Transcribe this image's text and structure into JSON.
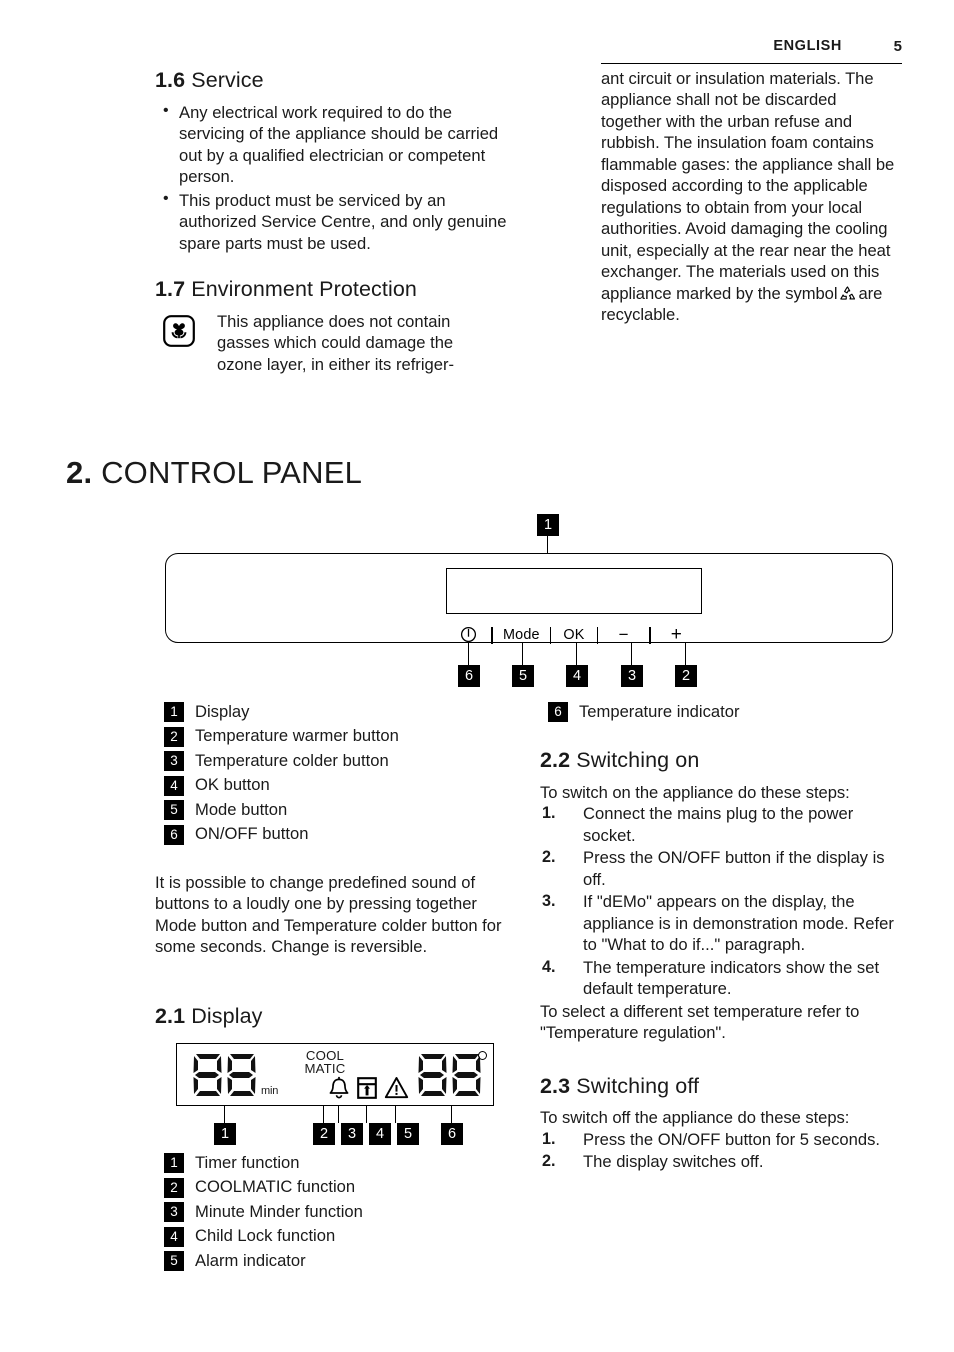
{
  "header": {
    "language": "ENGLISH",
    "page_number": "5"
  },
  "left_column": {
    "service": {
      "number": "1.6",
      "title": "Service",
      "bullets": [
        "Any electrical work required to do the servicing of the appliance should be carried out by a qualified electrician or competent person.",
        "This product must be serviced by an authorized Service Centre, and only genuine spare parts must be used."
      ]
    },
    "environment": {
      "number": "1.7",
      "title": "Environment Protection",
      "icon": "flower-icon",
      "text": "This appliance does not contain gasses which could damage the ozone layer, in either its refriger-"
    }
  },
  "right_column_top": {
    "continuation_part1": "ant circuit or insulation materials. The appliance shall not be discarded together with the urban refuse and rubbish. The insulation foam contains flammable gases: the appliance shall be disposed according to the applicable regulations to obtain from your local authorities. Avoid damaging the cooling unit, especially at the rear near the heat exchanger. The materials used on this appliance marked by the symbol",
    "continuation_part2": "are recyclable.",
    "inline_icon": "recycling-icon"
  },
  "chapter": {
    "number": "2.",
    "title": "CONTROL PANEL"
  },
  "control_panel": {
    "buttons": [
      {
        "id": "power",
        "label": "",
        "icon": "power-icon",
        "callout": "6"
      },
      {
        "id": "mode",
        "label": "Mode",
        "icon": "",
        "callout": "5"
      },
      {
        "id": "ok",
        "label": "OK",
        "icon": "",
        "callout": "4"
      },
      {
        "id": "minus",
        "label": "−",
        "icon": "minus-icon",
        "callout": "3"
      },
      {
        "id": "plus",
        "label": "+",
        "icon": "plus-icon",
        "callout": "2"
      }
    ],
    "display_callout": "1"
  },
  "panel_legend": {
    "items": [
      {
        "num": "1",
        "label": "Display"
      },
      {
        "num": "2",
        "label": "Temperature warmer button"
      },
      {
        "num": "3",
        "label": "Temperature colder button"
      },
      {
        "num": "4",
        "label": "OK button"
      },
      {
        "num": "5",
        "label": "Mode button"
      },
      {
        "num": "6",
        "label": "ON/OFF button"
      }
    ],
    "note": "It is possible to change predefined sound of buttons to a loudly one by pressing together Mode button and Temperature colder button for some seconds. Change is reversible."
  },
  "panel_legend_right": {
    "items": [
      {
        "num": "6",
        "label": "Temperature indicator"
      }
    ]
  },
  "display_section": {
    "number": "2.1",
    "title": "Display",
    "diagram": {
      "timer_digits": "88",
      "timer_unit": "min",
      "coolmatic_line1": "COOL",
      "coolmatic_line2": "MATIC",
      "bell_icon": "bell-icon",
      "child_lock_icon": "child-lock-icon",
      "alarm_icon": "warning-triangle-icon",
      "temp_digits": "88",
      "degree_symbol": "°",
      "callouts": [
        "1",
        "2",
        "3",
        "4",
        "5",
        "6"
      ]
    },
    "legend": [
      {
        "num": "1",
        "label": "Timer function"
      },
      {
        "num": "2",
        "label": "COOLMATIC function"
      },
      {
        "num": "3",
        "label": "Minute Minder function"
      },
      {
        "num": "4",
        "label": "Child Lock function"
      },
      {
        "num": "5",
        "label": "Alarm indicator"
      }
    ]
  },
  "switching_on": {
    "number": "2.2",
    "title": "Switching on",
    "intro": "To switch on the appliance do these steps:",
    "steps": [
      "Connect the mains plug to the power socket.",
      "Press the ON/OFF button if the display is off.",
      "If \"dEMo\" appears on the display, the appliance is in demonstration mode. Refer to \"What to do if...\" paragraph.",
      "The temperature indicators show the set default temperature."
    ],
    "outro": "To select a different set temperature refer to \"Temperature regulation\"."
  },
  "switching_off": {
    "number": "2.3",
    "title": "Switching off",
    "intro": "To switch off the appliance do these steps:",
    "steps": [
      "Press the ON/OFF button for 5 seconds.",
      "The display switches off."
    ]
  },
  "colors": {
    "text": "#1a1a1a",
    "badge_bg": "#000000",
    "badge_fg": "#ffffff"
  }
}
